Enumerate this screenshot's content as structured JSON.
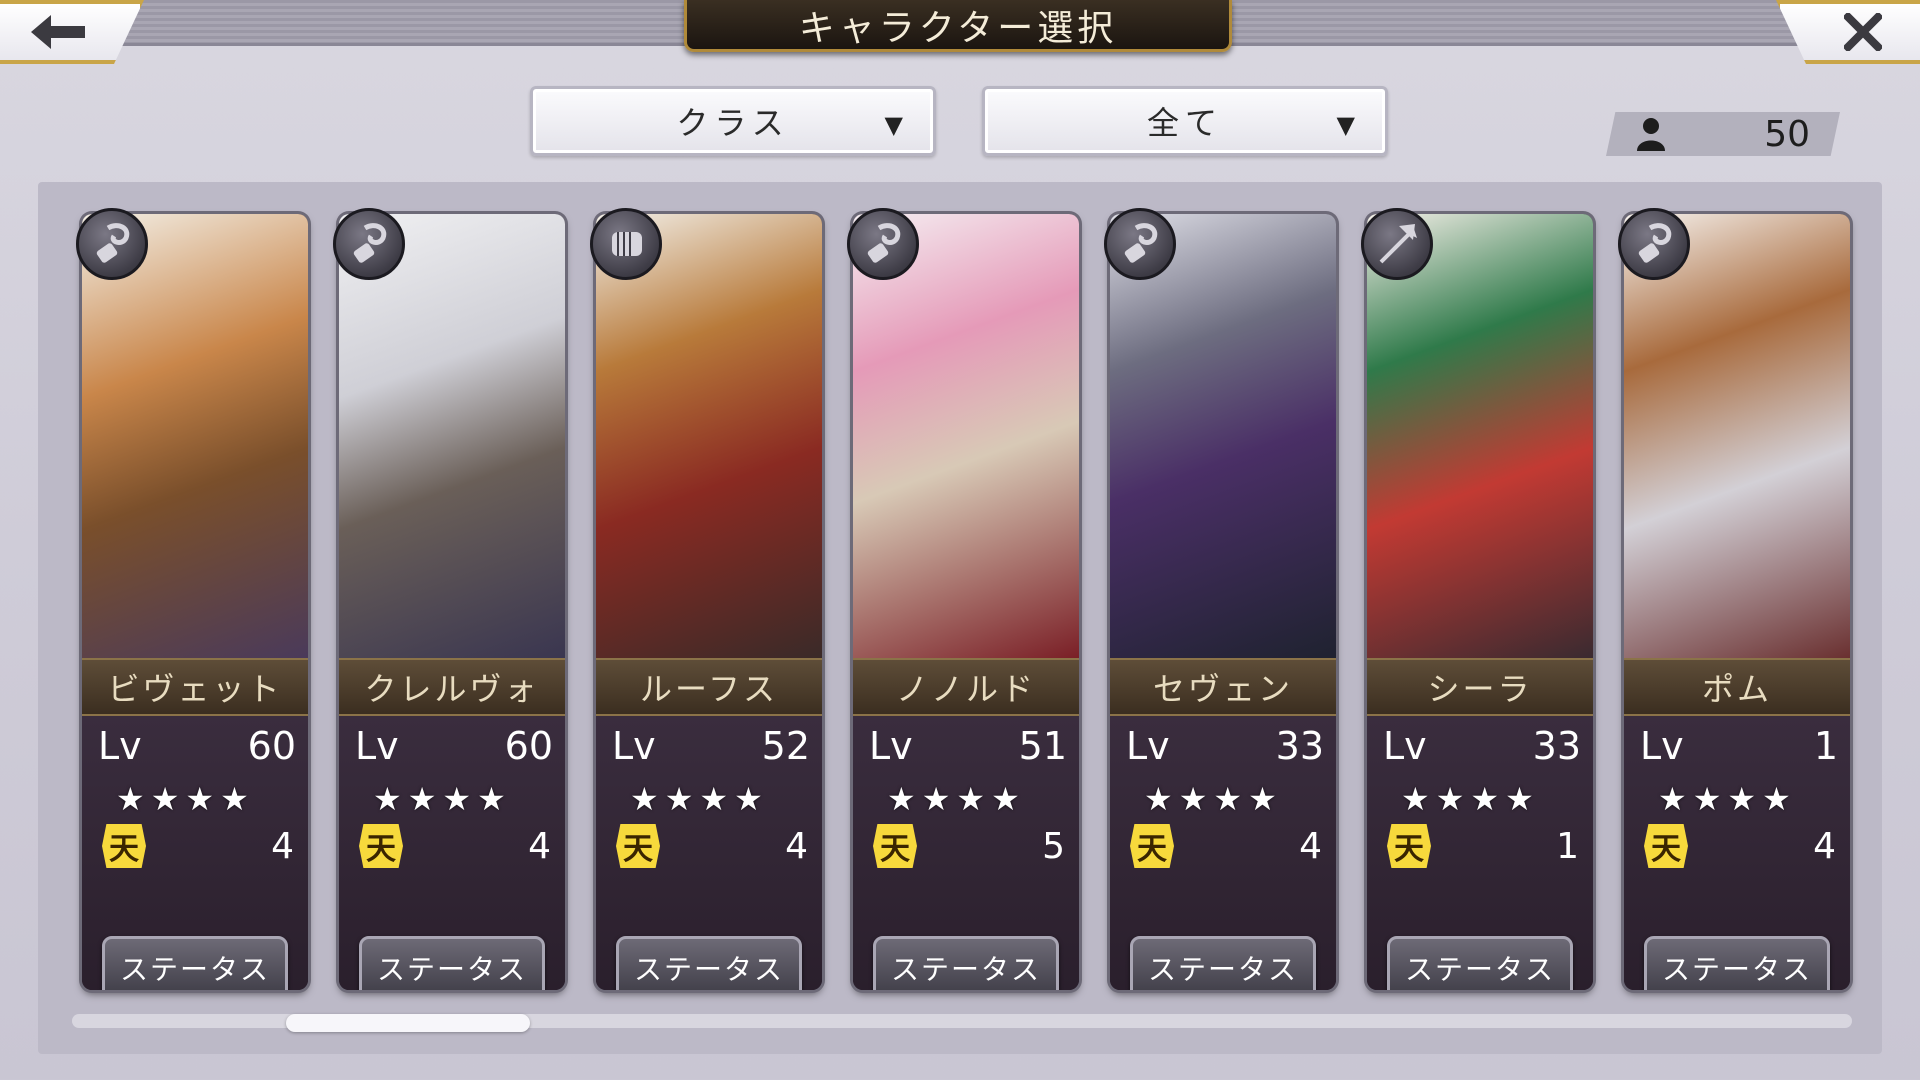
{
  "header": {
    "title": "キャラクター選択",
    "back_icon": "arrow-left-icon",
    "close_icon": "close-icon"
  },
  "filters": {
    "class_dropdown": {
      "label": "クラス",
      "arrow": "▼"
    },
    "scope_dropdown": {
      "label": "全て",
      "arrow": "▼"
    },
    "character_count": {
      "icon": "person-icon",
      "value": "50"
    }
  },
  "colors": {
    "accent_gold": "#c9a548",
    "panel": "#bcb9c7",
    "ten_badge": "#f7d93c"
  },
  "characters": [
    {
      "name": "ビヴェット",
      "lv_label": "Lv",
      "level": "60",
      "stars": 4,
      "ten_label": "天",
      "ten": "4",
      "status_label": "ステータス",
      "class_icon": "whip-icon"
    },
    {
      "name": "クレルヴォ",
      "lv_label": "Lv",
      "level": "60",
      "stars": 4,
      "ten_label": "天",
      "ten": "4",
      "status_label": "ステータス",
      "class_icon": "whip-icon"
    },
    {
      "name": "ルーフス",
      "lv_label": "Lv",
      "level": "52",
      "stars": 4,
      "ten_label": "天",
      "ten": "4",
      "status_label": "ステータス",
      "class_icon": "fist-icon"
    },
    {
      "name": "ノノルド",
      "lv_label": "Lv",
      "level": "51",
      "stars": 4,
      "ten_label": "天",
      "ten": "5",
      "status_label": "ステータス",
      "class_icon": "whip-icon"
    },
    {
      "name": "セヴェン",
      "lv_label": "Lv",
      "level": "33",
      "stars": 4,
      "ten_label": "天",
      "ten": "4",
      "status_label": "ステータス",
      "class_icon": "whip-icon"
    },
    {
      "name": "シーラ",
      "lv_label": "Lv",
      "level": "33",
      "stars": 4,
      "ten_label": "天",
      "ten": "1",
      "status_label": "ステータス",
      "class_icon": "arrow-icon"
    },
    {
      "name": "ポム",
      "lv_label": "Lv",
      "level": "1",
      "stars": 4,
      "ten_label": "天",
      "ten": "4",
      "status_label": "ステータス",
      "class_icon": "whip-icon"
    }
  ],
  "scroll": {
    "position_fraction": 0.12
  }
}
